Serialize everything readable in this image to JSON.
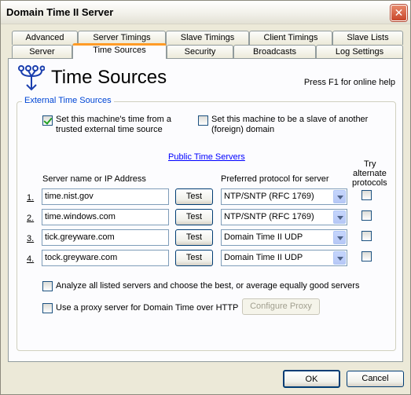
{
  "window": {
    "title": "Domain Time II Server",
    "close_glyph": "✕"
  },
  "tabs_back": [
    "Advanced",
    "Server Timings",
    "Slave Timings",
    "Client Timings",
    "Slave Lists"
  ],
  "tabs_front": [
    "Server",
    "Time Sources",
    "Security",
    "Broadcasts",
    "Log Settings"
  ],
  "active_tab": "Time Sources",
  "header": {
    "icon": "time-sources-network-icon",
    "title": "Time Sources",
    "help": "Press F1 for online help"
  },
  "group": {
    "label": "External Time Sources"
  },
  "options": {
    "trusted_line1": "Set this machine's time from a",
    "trusted_line2": "trusted external time source",
    "trusted_checked": true,
    "slave_line1": "Set this machine to be a slave of another",
    "slave_line2": "(foreign) domain",
    "slave_checked": false
  },
  "public_link": "Public Time Servers",
  "columns": {
    "server": "Server name or IP Address",
    "protocol": "Preferred protocol for server",
    "try_line1": "Try",
    "try_line2": "alternate",
    "try_line3": "protocols"
  },
  "servers": [
    {
      "num": "1.",
      "host": "time.nist.gov",
      "test": "Test",
      "protocol": "NTP/SNTP (RFC 1769)",
      "try_alt": false
    },
    {
      "num": "2.",
      "host": "time.windows.com",
      "test": "Test",
      "protocol": "NTP/SNTP (RFC 1769)",
      "try_alt": false
    },
    {
      "num": "3.",
      "host": "tick.greyware.com",
      "test": "Test",
      "protocol": "Domain Time II UDP",
      "try_alt": false
    },
    {
      "num": "4.",
      "host": "tock.greyware.com",
      "test": "Test",
      "protocol": "Domain Time II UDP",
      "try_alt": false
    }
  ],
  "analyze": {
    "label": "Analyze all listed servers and choose the best, or average equally good servers",
    "checked": false
  },
  "proxy": {
    "label": "Use a proxy server for Domain Time over HTTP",
    "checked": false,
    "configure": "Configure Proxy"
  },
  "footer": {
    "ok": "OK",
    "cancel": "Cancel"
  },
  "colors": {
    "accent_tab": "#ff9b26",
    "group_label": "#0046d5",
    "link": "#0000ff",
    "check": "#21a121"
  }
}
